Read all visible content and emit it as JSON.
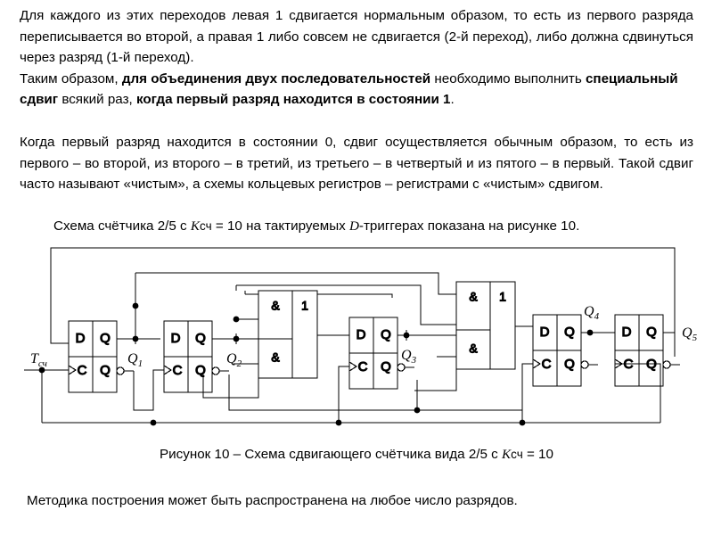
{
  "document": {
    "paragraphs": [
      {
        "id": "p1",
        "runs": [
          {
            "text": "Для каждого из этих переходов левая 1 сдвигается нормальным образом, то есть из первого разряда переписывается во второй, а правая 1 либо совсем не сдвигается (2-й переход), либо должна сдвинуться через разряд (1-й переход).",
            "bold": false
          },
          {
            "text": "\nТаким образом, ",
            "bold": false
          },
          {
            "text": "для объединения двух последовательностей",
            "bold": true
          },
          {
            "text": " необходимо выполнить ",
            "bold": false
          },
          {
            "text": "специальный сдвиг",
            "bold": true
          },
          {
            "text": " всякий раз, ",
            "bold": false
          },
          {
            "text": "когда первый разряд находится в состоянии 1",
            "bold": true
          },
          {
            "text": ".",
            "bold": false
          }
        ]
      },
      {
        "id": "p2",
        "runs": [
          {
            "text": "Когда первый разряд находится в состоянии 0, сдвиг осуществляется обычным образом, то есть из первого – во второй, из второго – в третий, из третьего – в четвертый и из пятого – в первый. Такой сдвиг часто называют «чистым», а схемы кольцевых регистров – регистрами с «чистым» сдвигом.",
            "bold": false
          }
        ]
      }
    ],
    "figure_intro": {
      "part1": "Схема счётчика 2/5 с ",
      "italic1": "K",
      "sub1": "сч",
      "part2": " = 10 на тактируемых ",
      "italic2": "D",
      "part3": "-триггерах показана на рисунке 10."
    },
    "figure_caption": {
      "part1": "Рисунок 10 – Схема сдвигающего счётчика вида 2/5 с ",
      "italic1": "K",
      "sub1": "сч",
      "part2": " = 10"
    },
    "closing": "Методика построения может быть распространена на любое число разрядов."
  },
  "figure": {
    "title": "Схема сдвигающего счётчика вида 2/5",
    "input_label": {
      "base": "T",
      "sub": "сч"
    },
    "flipflops": [
      {
        "name": "ff1",
        "d": "D",
        "c": "C",
        "q": "Q",
        "qn": "Q",
        "out_label": {
          "base": "Q",
          "sub": "1"
        }
      },
      {
        "name": "ff2",
        "d": "D",
        "c": "C",
        "q": "Q",
        "qn": "Q",
        "out_label": {
          "base": "Q",
          "sub": "2"
        }
      },
      {
        "name": "ff3",
        "d": "D",
        "c": "C",
        "q": "Q",
        "qn": "Q",
        "out_label": {
          "base": "Q",
          "sub": "3"
        }
      },
      {
        "name": "ff4",
        "d": "D",
        "c": "C",
        "q": "Q",
        "qn": "Q",
        "out_label": {
          "base": "Q",
          "sub": "4"
        }
      },
      {
        "name": "ff5",
        "d": "D",
        "c": "C",
        "q": "Q",
        "qn": "Q",
        "out_label": {
          "base": "Q",
          "sub": "5"
        }
      }
    ],
    "gates": [
      {
        "name": "gate-block-1",
        "and_upper": "&",
        "and_lower": "&",
        "or": "1"
      },
      {
        "name": "gate-block-2",
        "and_upper": "&",
        "and_lower": "&",
        "or": "1"
      }
    ],
    "colors": {
      "wire": "#000000",
      "box_stroke": "#000000",
      "background": "#ffffff",
      "text": "#000000"
    }
  }
}
